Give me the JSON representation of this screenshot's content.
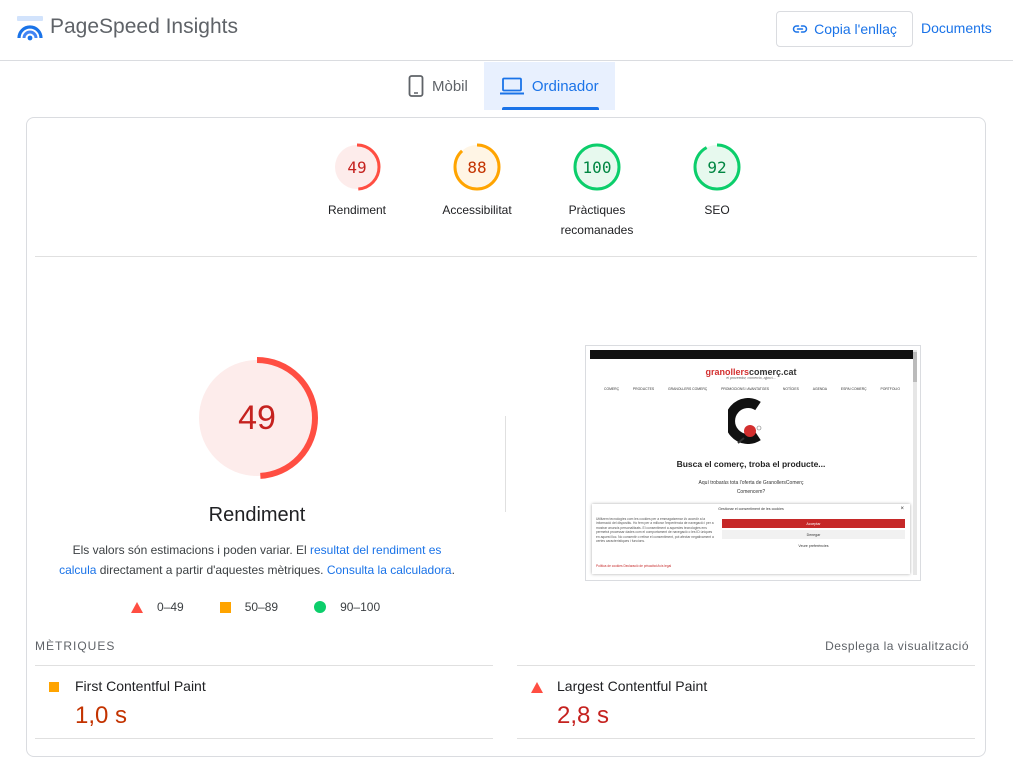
{
  "app": {
    "title": "PageSpeed Insights"
  },
  "header": {
    "copy_link_label": "Copia l'enllaç",
    "docs_label": "Documents"
  },
  "tabs": [
    {
      "label": "Mòbil",
      "icon": "smartphone-icon",
      "active": false
    },
    {
      "label": "Ordinador",
      "icon": "laptop-icon",
      "active": true
    }
  ],
  "colors": {
    "fail": "#ff4e42",
    "average": "#ffa400",
    "pass": "#0cce6b",
    "accent": "#1a73e8"
  },
  "scores": [
    {
      "label": "Rendiment",
      "value": "49",
      "status": "fail"
    },
    {
      "label": "Accessibilitat",
      "value": "88",
      "status": "average"
    },
    {
      "label": "Pràctiques recomanades",
      "value": "100",
      "status": "pass"
    },
    {
      "label": "SEO",
      "value": "92",
      "status": "pass"
    }
  ],
  "performance": {
    "score": "49",
    "title": "Rendiment",
    "desc_before": "Els valors són estimacions i poden variar. El ",
    "desc_link1": "resultat del rendiment es calcula",
    "desc_middle": " directament a partir d'aquestes mètriques. ",
    "desc_link2": "Consulta la calculadora",
    "desc_end": "."
  },
  "legend": [
    {
      "range": "0–49",
      "shape": "triangle"
    },
    {
      "range": "50–89",
      "shape": "square"
    },
    {
      "range": "90–100",
      "shape": "circle"
    }
  ],
  "screenshot": {
    "brand_red": "granollers",
    "brand_dark": "comerç.cat",
    "tagline": "el proveedor, comercio, ajpoci...",
    "nav": [
      "COMERÇ",
      "PRODUCTES",
      "GRANOLLERS COMERÇ",
      "PROMOCIONS I AVANTATGES",
      "NOTÍCIES",
      "AGENDA",
      "ESPAI COMERÇ",
      "PORTFOLIO"
    ],
    "headline": "Busca el comerç, troba el producte...",
    "sub1": "Aquí trobaràs tota l'oferta de GranollersComerç",
    "sub2": "Comencem?",
    "modal_title": "Gestionar el consentiment de les cookies",
    "modal_close": "×",
    "modal_text": "Utilitzem tecnologies com les cookies per a emmagatzemar i/o accedir a la informació del dispositiu. Ho fem per a millorar l'experiència de navegació i per a mostrar anuncis personalitzats. El consentiment a aquestes tecnologies ens permetrà processar dades com el comportament de navegació o les ID úniques en aquest lloc. No consentir o retirar el consentiment, pot afectar negativament a certes característiques i funcions.",
    "accept": "Acceptar",
    "deny": "Denegar",
    "prefs": "Veure preferències",
    "modal_links": "Política de cookies   Declaració de privacitat   Avís legal"
  },
  "metrics_section": {
    "label": "MÈTRIQUES",
    "expand_label": "Desplega la visualització"
  },
  "metrics": [
    {
      "name": "First Contentful Paint",
      "value": "1,0 s",
      "status": "average"
    },
    {
      "name": "Largest Contentful Paint",
      "value": "2,8 s",
      "status": "fail"
    }
  ]
}
